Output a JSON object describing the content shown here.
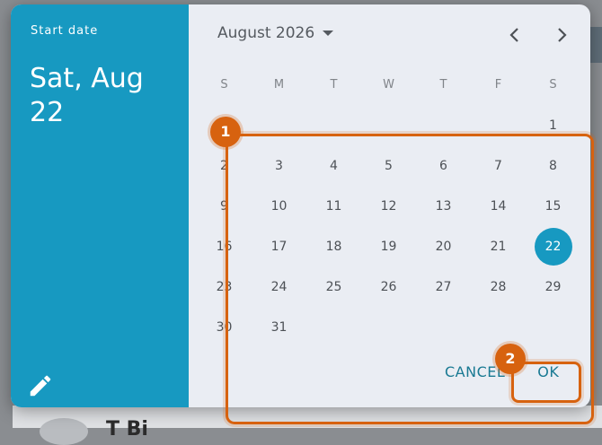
{
  "backdrop": {
    "partial_text": "T  Bi"
  },
  "dialog": {
    "header": {
      "label": "Start date",
      "selected_date": "Sat, Aug 22"
    },
    "calendar": {
      "month_label": "August 2026",
      "weekdays": [
        "S",
        "M",
        "T",
        "W",
        "T",
        "F",
        "S"
      ],
      "weeks": [
        [
          "",
          "",
          "",
          "",
          "",
          "",
          "1"
        ],
        [
          "2",
          "3",
          "4",
          "5",
          "6",
          "7",
          "8"
        ],
        [
          "9",
          "10",
          "11",
          "12",
          "13",
          "14",
          "15"
        ],
        [
          "16",
          "17",
          "18",
          "19",
          "20",
          "21",
          "22"
        ],
        [
          "23",
          "24",
          "25",
          "26",
          "27",
          "28",
          "29"
        ],
        [
          "30",
          "31",
          "",
          "",
          "",
          "",
          ""
        ]
      ],
      "selected_day": "22"
    },
    "actions": {
      "cancel_label": "CANCEL",
      "ok_label": "OK"
    }
  },
  "annotations": [
    {
      "number": "1"
    },
    {
      "number": "2"
    }
  ],
  "colors": {
    "accent": "#1799c1",
    "annotation": "#d7620f",
    "action_text": "#1a7a93"
  },
  "icons": {
    "month_dropdown": "caret-down-icon",
    "prev": "chevron-left-icon",
    "next": "chevron-right-icon",
    "edit": "pencil-icon"
  }
}
